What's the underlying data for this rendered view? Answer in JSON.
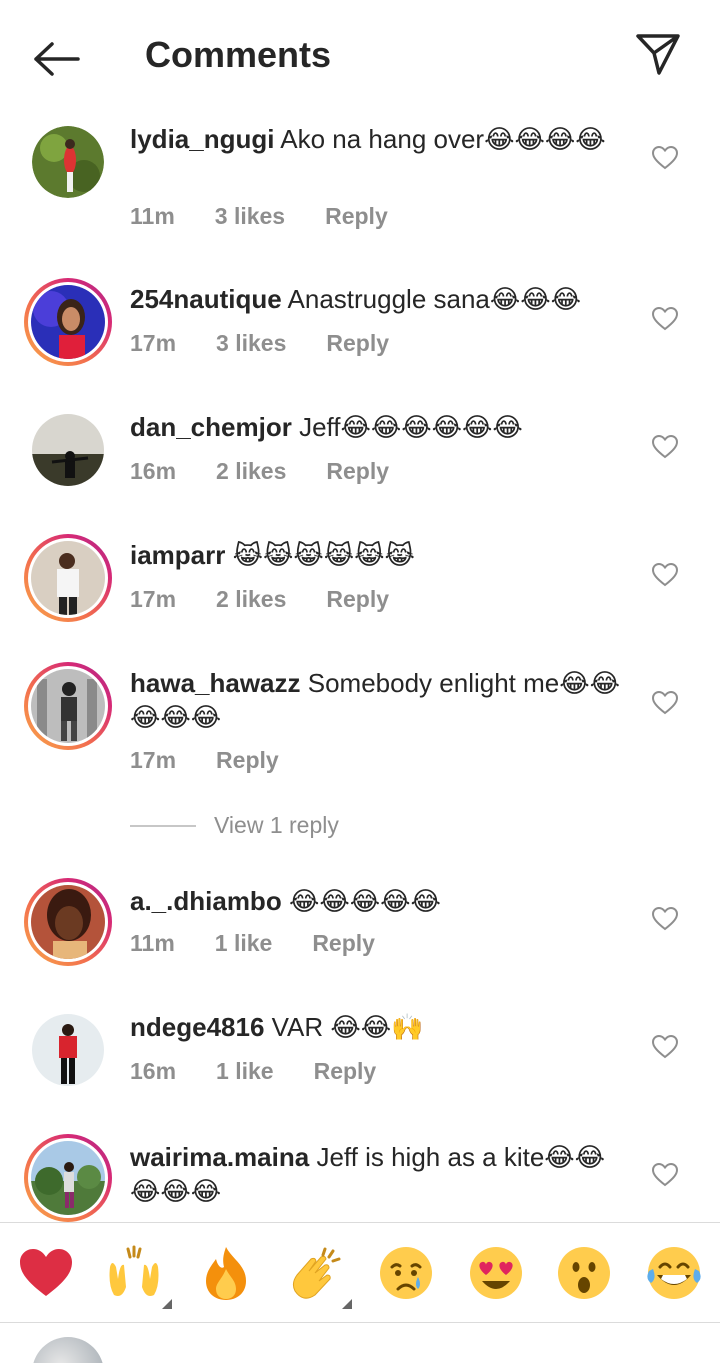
{
  "header": {
    "title": "Comments",
    "back_icon": "arrow-left-icon",
    "send_icon": "paper-plane-icon"
  },
  "comments": [
    {
      "username": "lydia_ngugi",
      "text": "Ako na hang over😂😂😂😂",
      "time": "11m",
      "likes": "3 likes",
      "reply": "Reply",
      "story": false
    },
    {
      "username": "254nautique",
      "text": "Anastruggle sana😂😂😂",
      "time": "17m",
      "likes": "3 likes",
      "reply": "Reply",
      "story": true
    },
    {
      "username": "dan_chemjor",
      "text": "Jeff😂😂😂😂😂😂",
      "time": "16m",
      "likes": "2 likes",
      "reply": "Reply",
      "story": false
    },
    {
      "username": "iamparr",
      "text": "😹😹😹😹😹😹",
      "time": "17m",
      "likes": "2 likes",
      "reply": "Reply",
      "story": true
    },
    {
      "username": "hawa_hawazz",
      "text": "Somebody enlight me😂😂😂😂😂",
      "time": "17m",
      "likes": "",
      "reply": "Reply",
      "story": true
    },
    {
      "username": "a._.dhiambo",
      "text": "😂😂😂😂😂",
      "time": "11m",
      "likes": "1 like",
      "reply": "Reply",
      "story": true
    },
    {
      "username": "ndege4816",
      "text": "VAR 😂😂🙌",
      "time": "16m",
      "likes": "1 like",
      "reply": "Reply",
      "story": false
    },
    {
      "username": "wairima.maina",
      "text": "Jeff is high as a kite😂😂😂😂😂",
      "time": "",
      "likes": "",
      "reply": "",
      "story": true
    }
  ],
  "view_replies": "View 1 reply",
  "reactions": [
    "❤️",
    "🙌",
    "🔥",
    "👏",
    "😢",
    "😍",
    "😮",
    "😂"
  ],
  "colors": {
    "text": "#262626",
    "secondary": "#8e8e8e",
    "divider": "#dbdbdb",
    "story_ring_start": "#f9a94a",
    "story_ring_end": "#a92d8c"
  }
}
